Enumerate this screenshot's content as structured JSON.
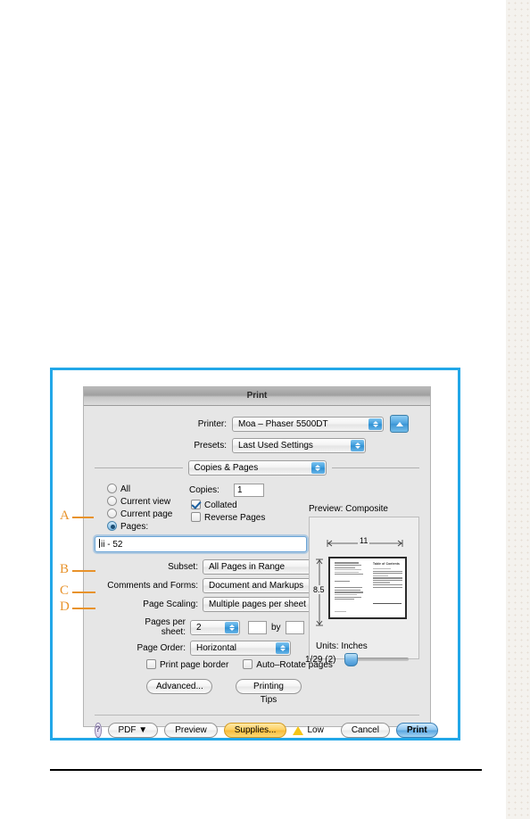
{
  "figure": {
    "border_color": "#22a7e8",
    "callout_color": "#e8922a",
    "callouts": [
      {
        "id": "A",
        "label": "A",
        "target": "pages-range-field"
      },
      {
        "id": "B",
        "label": "B",
        "target": "page-scaling-popup"
      },
      {
        "id": "C",
        "label": "C",
        "target": "pages-per-sheet-popup"
      },
      {
        "id": "D",
        "label": "D",
        "target": "page-order-popup"
      }
    ]
  },
  "dialog": {
    "title": "Print",
    "printer": {
      "label": "Printer:",
      "value": "Moa – Phaser 5500DT",
      "eject_icon": "eject-icon"
    },
    "presets": {
      "label": "Presets:",
      "value": "Last Used Settings"
    },
    "pane": {
      "value": "Copies & Pages"
    },
    "range": {
      "options": [
        {
          "label": "All",
          "selected": false
        },
        {
          "label": "Current view",
          "selected": false
        },
        {
          "label": "Current page",
          "selected": false
        },
        {
          "label": "Pages:",
          "selected": true
        }
      ],
      "pages_value": "ii - 52"
    },
    "copies": {
      "label": "Copies:",
      "value": "1",
      "collated_label": "Collated",
      "collated_checked": true,
      "reverse_label": "Reverse Pages",
      "reverse_checked": false
    },
    "subset": {
      "label": "Subset:",
      "value": "All Pages in Range"
    },
    "comments_and_forms": {
      "label": "Comments and Forms:",
      "value": "Document and Markups"
    },
    "page_scaling": {
      "label": "Page Scaling:",
      "value": "Multiple pages per sheet"
    },
    "pages_per_sheet": {
      "label": "Pages per sheet:",
      "value": "2",
      "by_label": "by",
      "custom_rows": "",
      "custom_cols": ""
    },
    "page_order": {
      "label": "Page Order:",
      "value": "Horizontal"
    },
    "print_page_border": {
      "label": "Print page border",
      "checked": false
    },
    "auto_rotate": {
      "label": "Auto–Rotate pages",
      "checked": false
    },
    "advanced_button": "Advanced...",
    "printing_tips_button": "Printing Tips",
    "preview": {
      "title": "Preview: Composite",
      "width_dim": "11",
      "height_dim": "8.5",
      "units": "Units: Inches",
      "page_counter": "1/29 (2)",
      "right_page_title": "Table of Contents"
    },
    "footer": {
      "help_label": "?",
      "pdf_label": "PDF ▼",
      "preview_label": "Preview",
      "supplies_label": "Supplies...",
      "supply_status": "Low",
      "warning_icon": "warning-triangle-icon",
      "cancel_label": "Cancel",
      "print_label": "Print"
    }
  }
}
